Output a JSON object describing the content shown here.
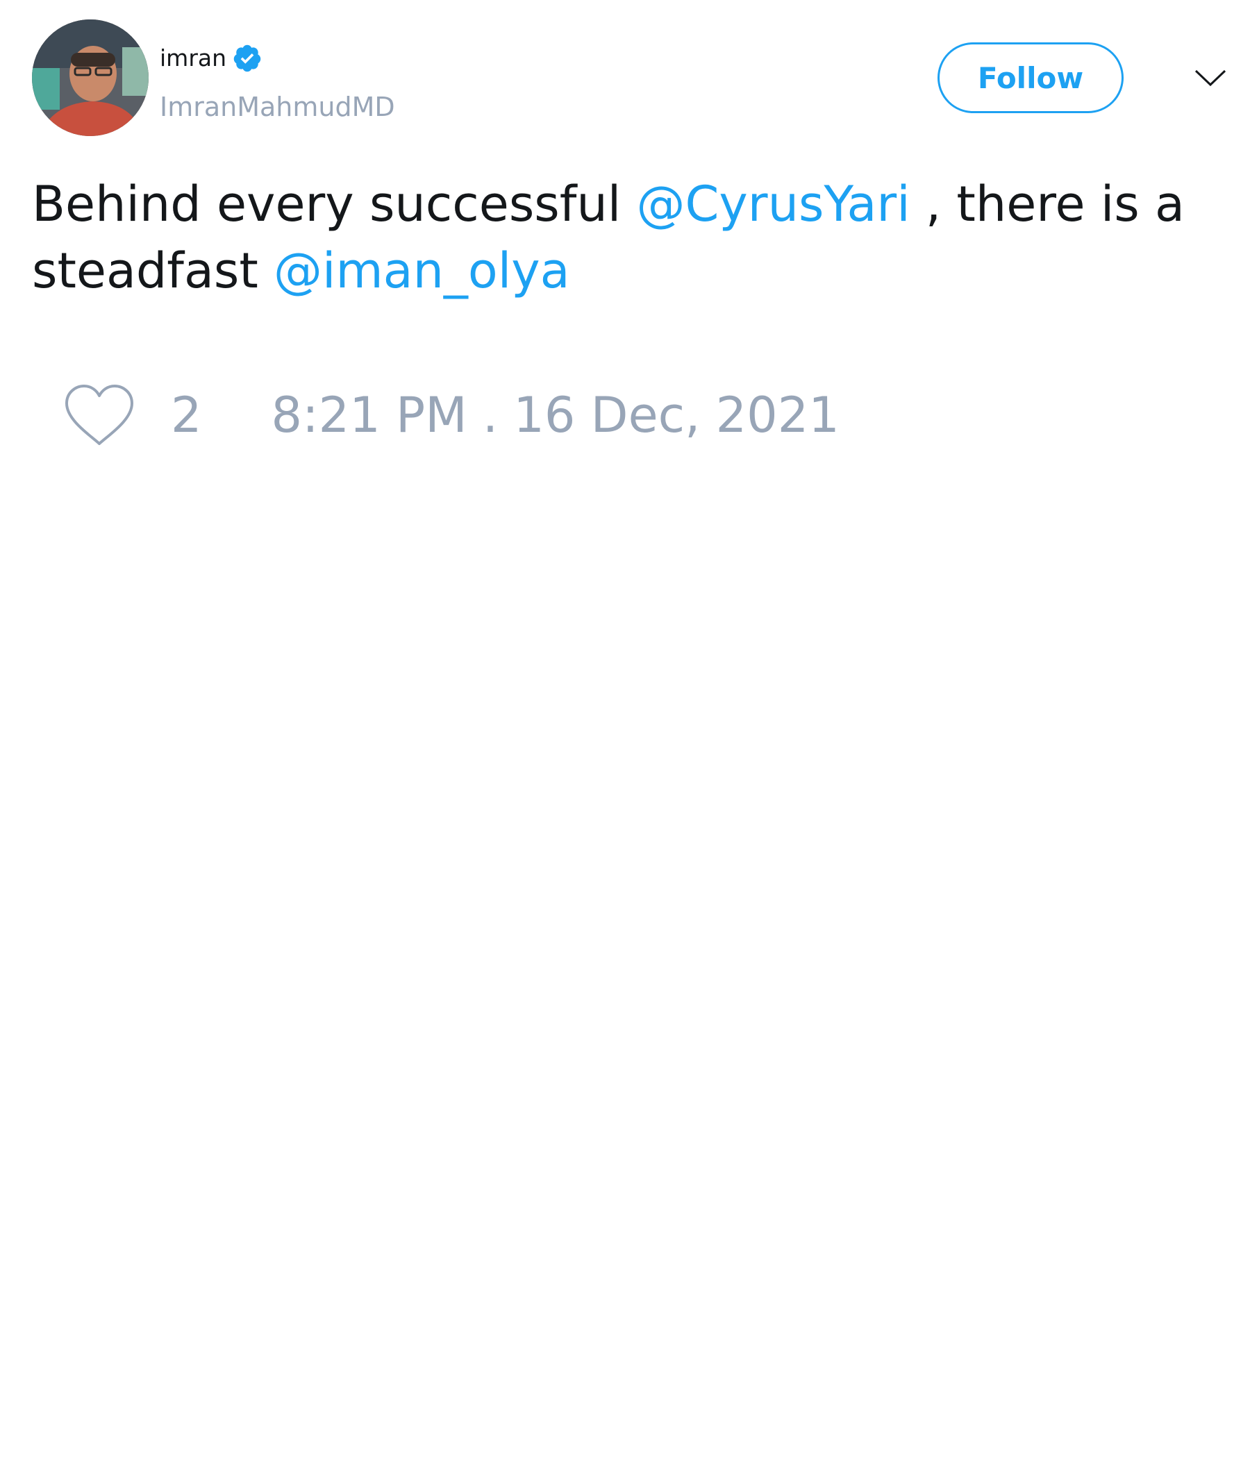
{
  "author": {
    "name": "imran",
    "handle": "ImranMahmudMD",
    "verified": true
  },
  "header": {
    "follow_label": "Follow",
    "menu_icon": "chevron-down-icon"
  },
  "tweet": {
    "text_part_1": "Behind every successful ",
    "mention_1": "@CyrusYari",
    "text_part_2": " , there is a steadfast ",
    "mention_2": "@iman_olya"
  },
  "footer": {
    "like_icon": "heart-icon",
    "like_count": "2",
    "timestamp": "8:21 PM . 16 Dec, 2021"
  },
  "colors": {
    "accent": "#1da1f2",
    "text": "#14171a",
    "muted": "#98a5b7",
    "background": "#ffffff"
  }
}
